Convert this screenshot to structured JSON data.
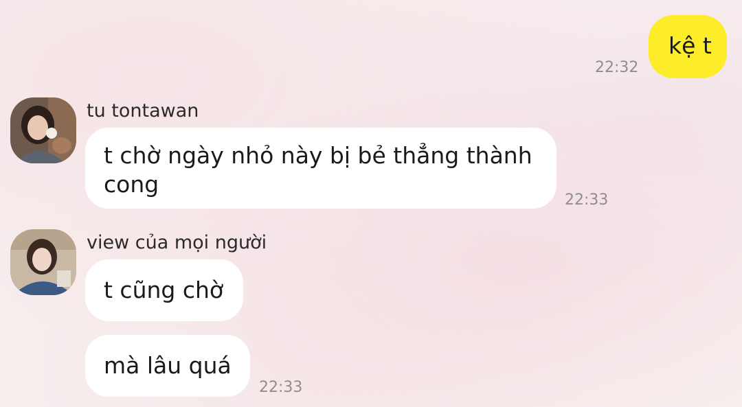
{
  "messages": [
    {
      "sender": "",
      "text": "kệ t",
      "time": "22:32"
    },
    {
      "sender": "tu tontawan",
      "text": "t chờ ngày nhỏ này bị bẻ thẳng thành cong",
      "time": "22:33"
    },
    {
      "sender": "view của mọi người",
      "text": "t cũng chờ",
      "time": ""
    },
    {
      "sender": "",
      "text": "mà lâu quá",
      "time": "22:33"
    }
  ],
  "colors": {
    "outgoing_bubble": "#fdec2a",
    "incoming_bubble": "#ffffff",
    "timestamp": "#8e8e8e"
  }
}
